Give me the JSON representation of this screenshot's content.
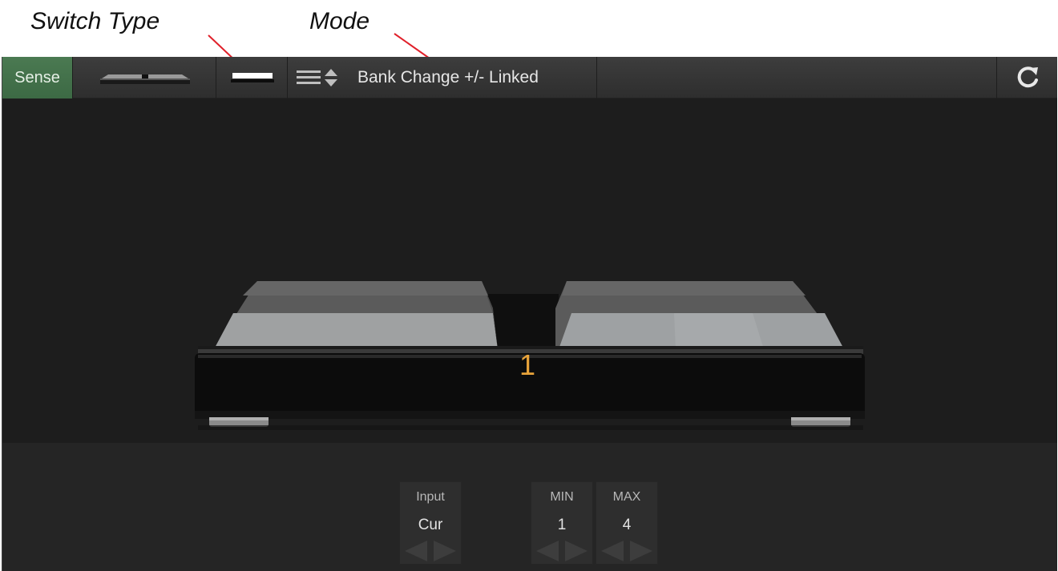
{
  "annotations": {
    "switch_type": "Switch Type",
    "mode": "Mode"
  },
  "toolbar": {
    "sense_label": "Sense",
    "mode_label": "Bank Change +/- Linked",
    "icons": {
      "pedal_thumbnail": "pedal-thumbnail-icon",
      "switch_type": "switch-type-icon",
      "mode_list": "list-sort-icon",
      "refresh": "refresh-icon"
    }
  },
  "pedal": {
    "bank_number": "1"
  },
  "params": {
    "input": {
      "label": "Input",
      "value": "Cur"
    },
    "min": {
      "label": "MIN",
      "value": "1"
    },
    "max": {
      "label": "MAX",
      "value": "4"
    }
  },
  "colors": {
    "sense_bg": "#3f6d47",
    "bank_number": "#e8a33a",
    "annotation_line": "#e0202a"
  }
}
